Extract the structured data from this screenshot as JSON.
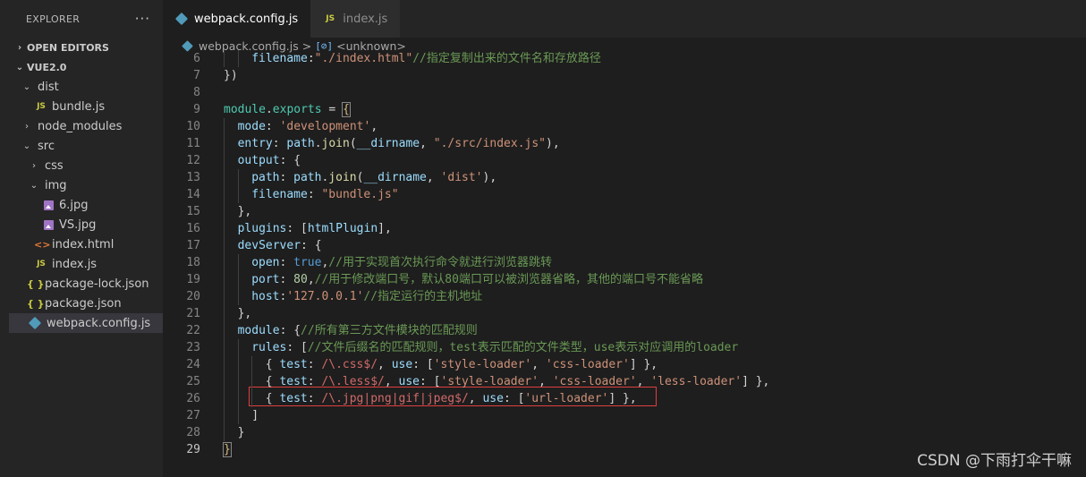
{
  "explorer": {
    "title": "EXPLORER",
    "more_glyph": "···",
    "open_editors": "OPEN EDITORS",
    "root": "VUE2.0",
    "tree": [
      {
        "name": "dist",
        "type": "folder",
        "open": true,
        "depth": 1
      },
      {
        "name": "bundle.js",
        "type": "js",
        "depth": 2
      },
      {
        "name": "node_modules",
        "type": "folder",
        "open": false,
        "depth": 1
      },
      {
        "name": "src",
        "type": "folder",
        "open": true,
        "depth": 1
      },
      {
        "name": "css",
        "type": "folder",
        "open": false,
        "depth": 2
      },
      {
        "name": "img",
        "type": "folder",
        "open": true,
        "depth": 2
      },
      {
        "name": "6.jpg",
        "type": "image",
        "depth": 3
      },
      {
        "name": "VS.jpg",
        "type": "image",
        "depth": 3
      },
      {
        "name": "index.html",
        "type": "html",
        "depth": 2
      },
      {
        "name": "index.js",
        "type": "js",
        "depth": 2
      },
      {
        "name": "package-lock.json",
        "type": "json",
        "depth": 1
      },
      {
        "name": "package.json",
        "type": "json",
        "depth": 1
      },
      {
        "name": "webpack.config.js",
        "type": "config",
        "depth": 1,
        "active": true
      }
    ]
  },
  "tabs": [
    {
      "label": "webpack.config.js",
      "type": "config",
      "active": true
    },
    {
      "label": "index.js",
      "type": "js",
      "active": false
    }
  ],
  "breadcrumb": {
    "file": "webpack.config.js",
    "separator": ">",
    "symbol": "<unknown>",
    "symbol_icon": "[⊘]"
  },
  "icons": {
    "js": "JS",
    "json": "{ }",
    "html": "<>"
  },
  "code_lines": [
    {
      "n": "6",
      "indent": 2,
      "tokens": [
        [
          "p",
          "filename"
        ],
        [
          "d",
          ":"
        ],
        [
          "s",
          "\"./index.html\""
        ],
        [
          "c",
          "//指定复制出来的文件名和存放路径"
        ]
      ]
    },
    {
      "n": "7",
      "indent": 0,
      "tokens": [
        [
          "d",
          "})"
        ]
      ]
    },
    {
      "n": "8",
      "indent": 0,
      "tokens": []
    },
    {
      "n": "9",
      "indent": 0,
      "tokens": [
        [
          "m",
          "module"
        ],
        [
          "d",
          "."
        ],
        [
          "m",
          "exports"
        ],
        [
          "d",
          " = "
        ],
        [
          "o",
          "{"
        ]
      ]
    },
    {
      "n": "10",
      "indent": 1,
      "tokens": [
        [
          "p",
          "mode"
        ],
        [
          "d",
          ": "
        ],
        [
          "s",
          "'development'"
        ],
        [
          "d",
          ","
        ]
      ]
    },
    {
      "n": "11",
      "indent": 1,
      "tokens": [
        [
          "p",
          "entry"
        ],
        [
          "d",
          ": "
        ],
        [
          "v",
          "path"
        ],
        [
          "d",
          "."
        ],
        [
          "f",
          "join"
        ],
        [
          "d",
          "("
        ],
        [
          "v",
          "__dirname"
        ],
        [
          "d",
          ", "
        ],
        [
          "s",
          "\"./src/index.js\""
        ],
        [
          "d",
          "),"
        ]
      ]
    },
    {
      "n": "12",
      "indent": 1,
      "tokens": [
        [
          "p",
          "output"
        ],
        [
          "d",
          ": {"
        ]
      ]
    },
    {
      "n": "13",
      "indent": 2,
      "tokens": [
        [
          "p",
          "path"
        ],
        [
          "d",
          ": "
        ],
        [
          "v",
          "path"
        ],
        [
          "d",
          "."
        ],
        [
          "f",
          "join"
        ],
        [
          "d",
          "("
        ],
        [
          "v",
          "__dirname"
        ],
        [
          "d",
          ", "
        ],
        [
          "s",
          "'dist'"
        ],
        [
          "d",
          "),"
        ]
      ]
    },
    {
      "n": "14",
      "indent": 2,
      "tokens": [
        [
          "p",
          "filename"
        ],
        [
          "d",
          ": "
        ],
        [
          "s",
          "\"bundle.js\""
        ]
      ]
    },
    {
      "n": "15",
      "indent": 1,
      "tokens": [
        [
          "d",
          "},"
        ]
      ]
    },
    {
      "n": "16",
      "indent": 1,
      "tokens": [
        [
          "p",
          "plugins"
        ],
        [
          "d",
          ": ["
        ],
        [
          "v",
          "htmlPlugin"
        ],
        [
          "d",
          "],"
        ]
      ]
    },
    {
      "n": "17",
      "indent": 1,
      "tokens": [
        [
          "p",
          "devServer"
        ],
        [
          "d",
          ": {"
        ]
      ]
    },
    {
      "n": "18",
      "indent": 2,
      "tokens": [
        [
          "p",
          "open"
        ],
        [
          "d",
          ": "
        ],
        [
          "k",
          "true"
        ],
        [
          "d",
          ","
        ],
        [
          "c",
          "//用于实现首次执行命令就进行浏览器跳转"
        ]
      ]
    },
    {
      "n": "19",
      "indent": 2,
      "tokens": [
        [
          "p",
          "port"
        ],
        [
          "d",
          ": "
        ],
        [
          "n",
          "80"
        ],
        [
          "d",
          ","
        ],
        [
          "c",
          "//用于修改端口号，默认80端口可以被浏览器省略，其他的端口号不能省略"
        ]
      ]
    },
    {
      "n": "20",
      "indent": 2,
      "tokens": [
        [
          "p",
          "host"
        ],
        [
          "d",
          ":"
        ],
        [
          "s",
          "'127.0.0.1'"
        ],
        [
          "c",
          "//指定运行的主机地址"
        ]
      ]
    },
    {
      "n": "21",
      "indent": 1,
      "tokens": [
        [
          "d",
          "},"
        ]
      ]
    },
    {
      "n": "22",
      "indent": 1,
      "tokens": [
        [
          "p",
          "module"
        ],
        [
          "d",
          ": {"
        ],
        [
          "c",
          "//所有第三方文件模块的匹配规则"
        ]
      ]
    },
    {
      "n": "23",
      "indent": 2,
      "tokens": [
        [
          "p",
          "rules"
        ],
        [
          "d",
          ": ["
        ],
        [
          "c",
          "//文件后缀名的匹配规则，test表示匹配的文件类型，use表示对应调用的loader"
        ]
      ]
    },
    {
      "n": "24",
      "indent": 3,
      "tokens": [
        [
          "d",
          "{ "
        ],
        [
          "p",
          "test"
        ],
        [
          "d",
          ": "
        ],
        [
          "r",
          "/\\.css$/"
        ],
        [
          "d",
          ", "
        ],
        [
          "p",
          "use"
        ],
        [
          "d",
          ": ["
        ],
        [
          "s",
          "'style-loader'"
        ],
        [
          "d",
          ", "
        ],
        [
          "s",
          "'css-loader'"
        ],
        [
          "d",
          "] },"
        ]
      ]
    },
    {
      "n": "25",
      "indent": 3,
      "tokens": [
        [
          "d",
          "{ "
        ],
        [
          "p",
          "test"
        ],
        [
          "d",
          ": "
        ],
        [
          "r",
          "/\\.less$/"
        ],
        [
          "d",
          ", "
        ],
        [
          "p",
          "use"
        ],
        [
          "d",
          ": ["
        ],
        [
          "s",
          "'style-loader'"
        ],
        [
          "d",
          ", "
        ],
        [
          "s",
          "'css-loader'"
        ],
        [
          "d",
          ", "
        ],
        [
          "s",
          "'less-loader'"
        ],
        [
          "d",
          "] },"
        ]
      ]
    },
    {
      "n": "26",
      "indent": 3,
      "tokens": [
        [
          "d",
          "{ "
        ],
        [
          "p",
          "test"
        ],
        [
          "d",
          ": "
        ],
        [
          "r",
          "/\\.jpg|png|gif|jpeg$/"
        ],
        [
          "d",
          ", "
        ],
        [
          "p",
          "use"
        ],
        [
          "d",
          ": ["
        ],
        [
          "s",
          "'url-loader'"
        ],
        [
          "d",
          "] },"
        ]
      ]
    },
    {
      "n": "27",
      "indent": 2,
      "tokens": [
        [
          "d",
          "]"
        ]
      ]
    },
    {
      "n": "28",
      "indent": 1,
      "tokens": [
        [
          "d",
          "}"
        ]
      ]
    },
    {
      "n": "29",
      "indent": 0,
      "tokens": [
        [
          "o",
          "}"
        ]
      ],
      "current": true
    }
  ],
  "watermark": "CSDN @下雨打伞干嘛"
}
